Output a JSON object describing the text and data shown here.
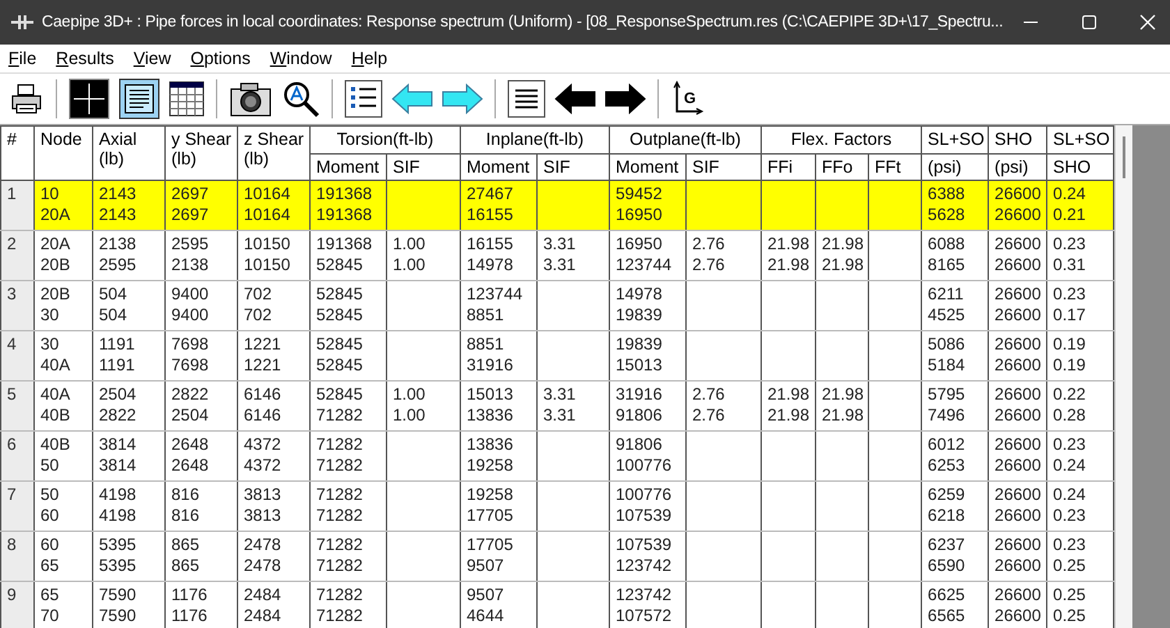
{
  "window": {
    "title": "Caepipe 3D+ : Pipe forces in local coordinates: Response spectrum (Uniform) -  [08_ResponseSpectrum.res (C:\\CAEPIPE 3D+\\17_Spectru..."
  },
  "menu": [
    "File",
    "Results",
    "View",
    "Options",
    "Window",
    "Help"
  ],
  "toolbar": [
    {
      "kind": "printer"
    },
    {
      "kind": "sep"
    },
    {
      "kind": "cross"
    },
    {
      "kind": "document"
    },
    {
      "kind": "table"
    },
    {
      "kind": "sep"
    },
    {
      "kind": "camera"
    },
    {
      "kind": "zoom"
    },
    {
      "kind": "sep"
    },
    {
      "kind": "list"
    },
    {
      "kind": "cyan-left"
    },
    {
      "kind": "cyan-right"
    },
    {
      "kind": "sep"
    },
    {
      "kind": "lines"
    },
    {
      "kind": "black-left"
    },
    {
      "kind": "black-right"
    },
    {
      "kind": "sep"
    },
    {
      "kind": "axes",
      "label": "G"
    }
  ],
  "header": [
    {
      "kind": "single",
      "label": "#"
    },
    {
      "kind": "single",
      "label": "Node"
    },
    {
      "kind": "unit",
      "label": "Axial",
      "unit": "(lb)"
    },
    {
      "kind": "unit",
      "label": "y Shear",
      "unit": "(lb)"
    },
    {
      "kind": "unit",
      "label": "z Shear",
      "unit": "(lb)"
    },
    {
      "kind": "group",
      "label": "Torsion(ft-lb)",
      "subs": [
        "Moment",
        "SIF"
      ]
    },
    {
      "kind": "group",
      "label": "Inplane(ft-lb)",
      "subs": [
        "Moment",
        "SIF"
      ]
    },
    {
      "kind": "group",
      "label": "Outplane(ft-lb)",
      "subs": [
        "Moment",
        "SIF"
      ]
    },
    {
      "kind": "group",
      "label": "Flex. Factors",
      "subs": [
        "FFi",
        "FFo",
        "FFt"
      ]
    },
    {
      "kind": "group",
      "label": "SL+SO",
      "subs": [
        "(psi)"
      ]
    },
    {
      "kind": "group",
      "label": "SHO",
      "subs": [
        "(psi)"
      ]
    },
    {
      "kind": "group",
      "label": "SL+SO",
      "subs": [
        "SHO"
      ]
    }
  ],
  "rows": [
    {
      "number": "1",
      "selected": true,
      "values": {
        "node": [
          "10",
          "20A"
        ],
        "axial": [
          "2143",
          "2143"
        ],
        "y_shear": [
          "2697",
          "2697"
        ],
        "z_shear": [
          "10164",
          "10164"
        ],
        "torsion_moment": [
          "191368",
          "191368"
        ],
        "inplane_moment": [
          "27467",
          "16155"
        ],
        "outplane_moment": [
          "59452",
          "16950"
        ],
        "sl_so": [
          "6388",
          "5628"
        ],
        "sho": [
          "26600",
          "26600"
        ],
        "ratio": [
          "0.24",
          "0.21"
        ]
      }
    },
    {
      "number": "2",
      "selected": false,
      "values": {
        "node": [
          "20A",
          "20B"
        ],
        "axial": [
          "2138",
          "2595"
        ],
        "y_shear": [
          "2595",
          "2138"
        ],
        "z_shear": [
          "10150",
          "10150"
        ],
        "torsion_moment": [
          "191368",
          "52845"
        ],
        "torsion_sif": [
          "1.00",
          "1.00"
        ],
        "inplane_moment": [
          "16155",
          "14978"
        ],
        "inplane_sif": [
          "3.31",
          "3.31"
        ],
        "outplane_moment": [
          "16950",
          "123744"
        ],
        "outplane_sif": [
          "2.76",
          "2.76"
        ],
        "ffi": [
          "21.98",
          "21.98"
        ],
        "ffo": [
          "21.98",
          "21.98"
        ],
        "sl_so": [
          "6088",
          "8165"
        ],
        "sho": [
          "26600",
          "26600"
        ],
        "ratio": [
          "0.23",
          "0.31"
        ]
      }
    },
    {
      "number": "3",
      "selected": false,
      "values": {
        "node": [
          "20B",
          "30"
        ],
        "axial": [
          "504",
          "504"
        ],
        "y_shear": [
          "9400",
          "9400"
        ],
        "z_shear": [
          "702",
          "702"
        ],
        "torsion_moment": [
          "52845",
          "52845"
        ],
        "inplane_moment": [
          "123744",
          "8851"
        ],
        "outplane_moment": [
          "14978",
          "19839"
        ],
        "sl_so": [
          "6211",
          "4525"
        ],
        "sho": [
          "26600",
          "26600"
        ],
        "ratio": [
          "0.23",
          "0.17"
        ]
      }
    },
    {
      "number": "4",
      "selected": false,
      "values": {
        "node": [
          "30",
          "40A"
        ],
        "axial": [
          "1191",
          "1191"
        ],
        "y_shear": [
          "7698",
          "7698"
        ],
        "z_shear": [
          "1221",
          "1221"
        ],
        "torsion_moment": [
          "52845",
          "52845"
        ],
        "inplane_moment": [
          "8851",
          "31916"
        ],
        "outplane_moment": [
          "19839",
          "15013"
        ],
        "sl_so": [
          "5086",
          "5184"
        ],
        "sho": [
          "26600",
          "26600"
        ],
        "ratio": [
          "0.19",
          "0.19"
        ]
      }
    },
    {
      "number": "5",
      "selected": false,
      "values": {
        "node": [
          "40A",
          "40B"
        ],
        "axial": [
          "2504",
          "2822"
        ],
        "y_shear": [
          "2822",
          "2504"
        ],
        "z_shear": [
          "6146",
          "6146"
        ],
        "torsion_moment": [
          "52845",
          "71282"
        ],
        "torsion_sif": [
          "1.00",
          "1.00"
        ],
        "inplane_moment": [
          "15013",
          "13836"
        ],
        "inplane_sif": [
          "3.31",
          "3.31"
        ],
        "outplane_moment": [
          "31916",
          "91806"
        ],
        "outplane_sif": [
          "2.76",
          "2.76"
        ],
        "ffi": [
          "21.98",
          "21.98"
        ],
        "ffo": [
          "21.98",
          "21.98"
        ],
        "sl_so": [
          "5795",
          "7496"
        ],
        "sho": [
          "26600",
          "26600"
        ],
        "ratio": [
          "0.22",
          "0.28"
        ]
      }
    },
    {
      "number": "6",
      "selected": false,
      "values": {
        "node": [
          "40B",
          "50"
        ],
        "axial": [
          "3814",
          "3814"
        ],
        "y_shear": [
          "2648",
          "2648"
        ],
        "z_shear": [
          "4372",
          "4372"
        ],
        "torsion_moment": [
          "71282",
          "71282"
        ],
        "inplane_moment": [
          "13836",
          "19258"
        ],
        "outplane_moment": [
          "91806",
          "100776"
        ],
        "sl_so": [
          "6012",
          "6253"
        ],
        "sho": [
          "26600",
          "26600"
        ],
        "ratio": [
          "0.23",
          "0.24"
        ]
      }
    },
    {
      "number": "7",
      "selected": false,
      "values": {
        "node": [
          "50",
          "60"
        ],
        "axial": [
          "4198",
          "4198"
        ],
        "y_shear": [
          "816",
          "816"
        ],
        "z_shear": [
          "3813",
          "3813"
        ],
        "torsion_moment": [
          "71282",
          "71282"
        ],
        "inplane_moment": [
          "19258",
          "17705"
        ],
        "outplane_moment": [
          "100776",
          "107539"
        ],
        "sl_so": [
          "6259",
          "6218"
        ],
        "sho": [
          "26600",
          "26600"
        ],
        "ratio": [
          "0.24",
          "0.23"
        ]
      }
    },
    {
      "number": "8",
      "selected": false,
      "values": {
        "node": [
          "60",
          "65"
        ],
        "axial": [
          "5395",
          "5395"
        ],
        "y_shear": [
          "865",
          "865"
        ],
        "z_shear": [
          "2478",
          "2478"
        ],
        "torsion_moment": [
          "71282",
          "71282"
        ],
        "inplane_moment": [
          "17705",
          "9507"
        ],
        "outplane_moment": [
          "107539",
          "123742"
        ],
        "sl_so": [
          "6237",
          "6590"
        ],
        "sho": [
          "26600",
          "26600"
        ],
        "ratio": [
          "0.23",
          "0.25"
        ]
      }
    },
    {
      "number": "9",
      "selected": false,
      "values": {
        "node": [
          "65",
          "70"
        ],
        "axial": [
          "7590",
          "7590"
        ],
        "y_shear": [
          "1176",
          "1176"
        ],
        "z_shear": [
          "2484",
          "2484"
        ],
        "torsion_moment": [
          "71282",
          "71282"
        ],
        "inplane_moment": [
          "9507",
          "4644"
        ],
        "outplane_moment": [
          "123742",
          "107572"
        ],
        "sl_so": [
          "6625",
          "6565"
        ],
        "sho": [
          "26600",
          "26600"
        ],
        "ratio": [
          "0.25",
          "0.25"
        ]
      }
    }
  ]
}
